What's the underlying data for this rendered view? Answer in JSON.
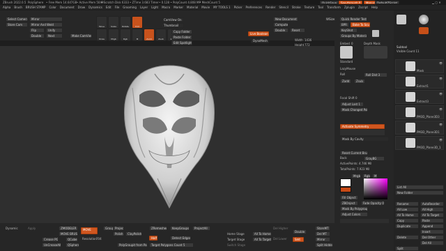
{
  "title_bar": {
    "app": "ZBrush 2022.0.5",
    "doc": "PolySphere",
    "free_mem": "• Free Mem 14.647GB",
    "active_mem": "• Active Mem 5049",
    "scratch": "• Scratch Disk 6333",
    "ztime": "• ZTime 3.683 Timer",
    "poly": "• 0.128 • PolyCount 4.808 MP",
    "mesh": "• MeshCount 5",
    "quicksave": "QuickSave",
    "seethrough": "See-through 0",
    "menus": "Menus",
    "script": "DefaultZScript"
  },
  "menu_bar": [
    "Alpha",
    "Brush",
    "BRUSH STAMP",
    "Color",
    "Document",
    "Draw",
    "Dynamics",
    "Edit",
    "File",
    "Grooming",
    "Layer",
    "Light",
    "Macro",
    "Marker",
    "Material",
    "Movie",
    "MY TOOLS 1",
    "Picker",
    "Preferences",
    "Render",
    "Stencil",
    "Stroke",
    "Texture",
    "Tool",
    "Transform",
    "Zplugin",
    "Zscript",
    "Help"
  ],
  "top_shelf": {
    "select_camera": "Select Camera",
    "store_cam": "Store Cam",
    "mirror": "Mirror",
    "mirror_weld": "Mirror And Weld",
    "flip": "Flip",
    "unify": "Unify",
    "double": "Double",
    "next": "Next",
    "make_camview": "Make CamView",
    "camview_on": "CamView On",
    "thumbnail": "Thumbnail",
    "copy_folder": "Copy Folder",
    "paste_folder": "Paste Folder",
    "edit_spotlight": "Edit Spotlight",
    "live_boolean": "Live Boolean",
    "new_document": "New Document",
    "compute": "Compute",
    "double2": "Double",
    "reset": "Reset",
    "dynamesh": "DynaMesh",
    "width_label": "Width",
    "width_val": "1436",
    "height_label": "Height",
    "height_val": "772",
    "wsize": "WSize",
    "quick_render": "Quick Render Test",
    "bpr": "BPR",
    "bake": "Bake To Sculpt",
    "keyshot": "KeyShot",
    "groups_by_mat": "Groups By Materials",
    "quick_tools": "Quick Tools"
  },
  "draw_tools": [
    {
      "name": "Move",
      "active": false
    },
    {
      "name": "Scale",
      "active": false
    },
    {
      "name": "Rotate",
      "active": false
    },
    {
      "name": "Edit",
      "active": true
    },
    {
      "name": "Draw",
      "active": false
    },
    {
      "name": "Mrgb",
      "active": false
    },
    {
      "name": "Rgb",
      "active": false
    },
    {
      "name": "M",
      "active": false
    },
    {
      "name": "Zadd",
      "active": true
    },
    {
      "name": "Zsub",
      "active": false
    },
    {
      "name": "Zcut",
      "active": false
    }
  ],
  "right_panel": {
    "embed_label": "Embed",
    "embed_val": "0",
    "depth_mask": "Depth Mask",
    "inner_depth": "Inner Depth",
    "inner_val": "0.2",
    "outer_depth": "Outer Depth",
    "standard": "Standard",
    "lazymouse": "LazyMouse",
    "roll": "Roll",
    "roll_dist": "Roll Dist 3",
    "zadd": "Zadd",
    "zsub": "Zsub",
    "zsub_val": "0",
    "focal_shift_label": "Focal Shift",
    "focal_shift_val": "0",
    "adjust_last": "Adjust Last 1",
    "mask_changed": "Mask Changed Points",
    "activate_symmetry": "Activate Symmetry",
    "mask_by_cavity": "Mask By Cavity",
    "brush_alpha": "BrushAlpha",
    "modifiers": "Modifiers",
    "reset_brush": "Reset Current Brush",
    "back": "Back",
    "grayblend": "GrayBG",
    "active_points": "ActivePoints: 4.746 Mil",
    "total_points": "TotalPoints: 7.923 Mil",
    "mrgb": "Mrgb",
    "rgb": "Rgb",
    "m": "M",
    "fill_object": "Fill Object",
    "fade_opacity": "Fade Opacity 0",
    "zbrush_color": "ZBOnject",
    "mask_by_polygroups": "Mask By Polygroups",
    "adjust_colors": "Adjust Colors",
    "sketch": "Sketch",
    "lightbox": "LightBox",
    "spotlight": "Spotlight"
  },
  "subtool": {
    "header": "Subtool",
    "visible_count": "Visible Count 11",
    "items": [
      {
        "name": "Mask"
      },
      {
        "name": "Extract1"
      },
      {
        "name": "Extract3"
      },
      {
        "name": "PM3D_Plane3D3"
      },
      {
        "name": "PM3D_Plane3D1"
      },
      {
        "name": "PM3D_Plane3D_1"
      }
    ],
    "list_all": "List All",
    "new_folder": "New Folder",
    "rename": "Rename",
    "autoreorder": "AutoReorder",
    "all_low": "All Low",
    "all_high": "All High",
    "all_to_home": "All To Home",
    "all_to_target": "All To Target",
    "copy": "Copy",
    "paste": "Paste",
    "duplicate": "Duplicate",
    "append": "Append",
    "insert": "Insert",
    "delete": "Delete",
    "del_other": "Del Other",
    "del_all": "Del All",
    "split": "Split",
    "cursor": "Cursor",
    "spheres": "Sphere3D_1",
    "sphere_count": "4",
    "simple_brush": "SimpleBrush"
  },
  "bottom_shelf": {
    "dynamic": "Dynamic",
    "apply": "Apply",
    "zmodeler": "ZMODELER",
    "move_brush": "MOVE BRUSH",
    "move": "MOVE",
    "crease_pg": "Crease PG",
    "qcube": "QCube",
    "uncrease_all": "UnCreaseAll",
    "qsphere": "QSphere",
    "clipcurve": "ClipCurve",
    "groups_fetch": "Groups",
    "polish": "Polish",
    "project": "Project",
    "claypolish": "ClayPolish",
    "resolution_label": "Resolution",
    "resolution_val": "704",
    "zremesher": "ZRemesher",
    "keepgroups": "KeepGroups",
    "project_all": "ProjectAll",
    "half": "Half",
    "detect_edges": "Detect Edges",
    "target_poly": "Target Polygons Count 5",
    "polygroup_polypaint": "PolyGroupit from Paint",
    "home_stage": "Home Stage",
    "target_stage": "Target Stage",
    "switch_stage": "Switch Stage",
    "all_to_home": "All To Home",
    "all_to_target": "All To Target",
    "del_higher": "Del Higher",
    "del_lower": "Del Lower",
    "smt": "Smt",
    "double": "Double",
    "store_mt": "StoreMT",
    "del_mt": "Del MT",
    "mirror": "Mirror",
    "split_hidden": "Split Hidden"
  },
  "colors": {
    "accent": "#d0561f",
    "bg": "#262626",
    "canvas": "#2f2f2f",
    "sculpt": "#e4e4e4"
  }
}
